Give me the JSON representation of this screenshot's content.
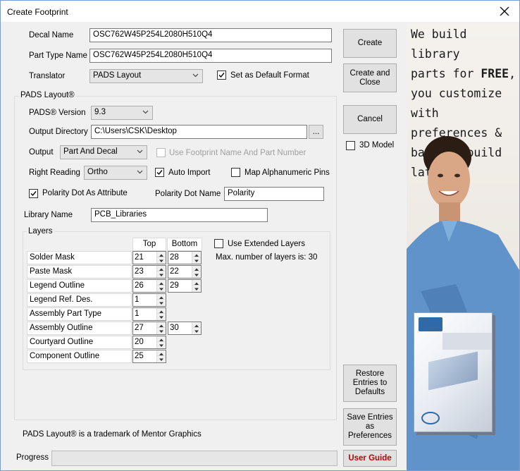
{
  "window": {
    "title": "Create Footprint",
    "close_icon": "close-icon"
  },
  "fields": {
    "decal_name_label": "Decal Name",
    "decal_name_value": "OSC762W45P254L2080H510Q4",
    "part_type_label": "Part Type Name",
    "part_type_value": "OSC762W45P254L2080H510Q4",
    "translator_label": "Translator",
    "translator_value": "PADS Layout",
    "set_default_label": "Set as Default Format"
  },
  "pads": {
    "group_title": "PADS Layout®",
    "version_label": "PADS® Version",
    "version_value": "9.3",
    "output_dir_label": "Output Directory",
    "output_dir_value": "C:\\Users\\CSK\\Desktop",
    "browse_label": "...",
    "output_label": "Output",
    "output_value": "Part And Decal",
    "use_footprint_label": "Use Footprint Name And Part Number",
    "right_reading_label": "Right Reading",
    "right_reading_value": "Ortho",
    "auto_import_label": "Auto Import",
    "map_alnum_label": "Map Alphanumeric Pins",
    "polarity_attr_label": "Polarity Dot As Attribute",
    "polarity_name_label": "Polarity Dot Name",
    "polarity_name_value": "Polarity",
    "library_name_label": "Library Name",
    "library_name_value": "PCB_Libraries"
  },
  "layers": {
    "group_title": "Layers",
    "col_top": "Top",
    "col_bottom": "Bottom",
    "use_extended_label": "Use Extended Layers",
    "max_layers_text": "Max. number of layers is: 30",
    "rows": [
      {
        "name": "Solder Mask",
        "top": "21",
        "bottom": "28"
      },
      {
        "name": "Paste Mask",
        "top": "23",
        "bottom": "22"
      },
      {
        "name": "Legend Outline",
        "top": "26",
        "bottom": "29"
      },
      {
        "name": "Legend Ref. Des.",
        "top": "1",
        "bottom": ""
      },
      {
        "name": "Assembly Part Type",
        "top": "1",
        "bottom": ""
      },
      {
        "name": "Assembly Outline",
        "top": "27",
        "bottom": "30"
      },
      {
        "name": "Courtyard Outline",
        "top": "20",
        "bottom": ""
      },
      {
        "name": "Component Outline",
        "top": "25",
        "bottom": ""
      }
    ]
  },
  "buttons": {
    "create": "Create",
    "create_close": "Create and Close",
    "cancel": "Cancel",
    "model_3d": "3D Model",
    "restore": "Restore Entries to Defaults",
    "save_prefs": "Save Entries as Preferences",
    "user_guide": "User Guide"
  },
  "footer": {
    "trademark": "PADS Layout® is a trademark of Mentor Graphics",
    "progress_label": "Progress"
  },
  "ad": {
    "line1": "We build library",
    "line2a": "parts for ",
    "line2b": "FREE",
    "line2c": ",",
    "line3": "you customize",
    "line4": "with preferences &",
    "line5": "batch-rebuild later!"
  },
  "colors": {
    "accent_red": "#c00000",
    "window_border": "#7a9cd3"
  }
}
